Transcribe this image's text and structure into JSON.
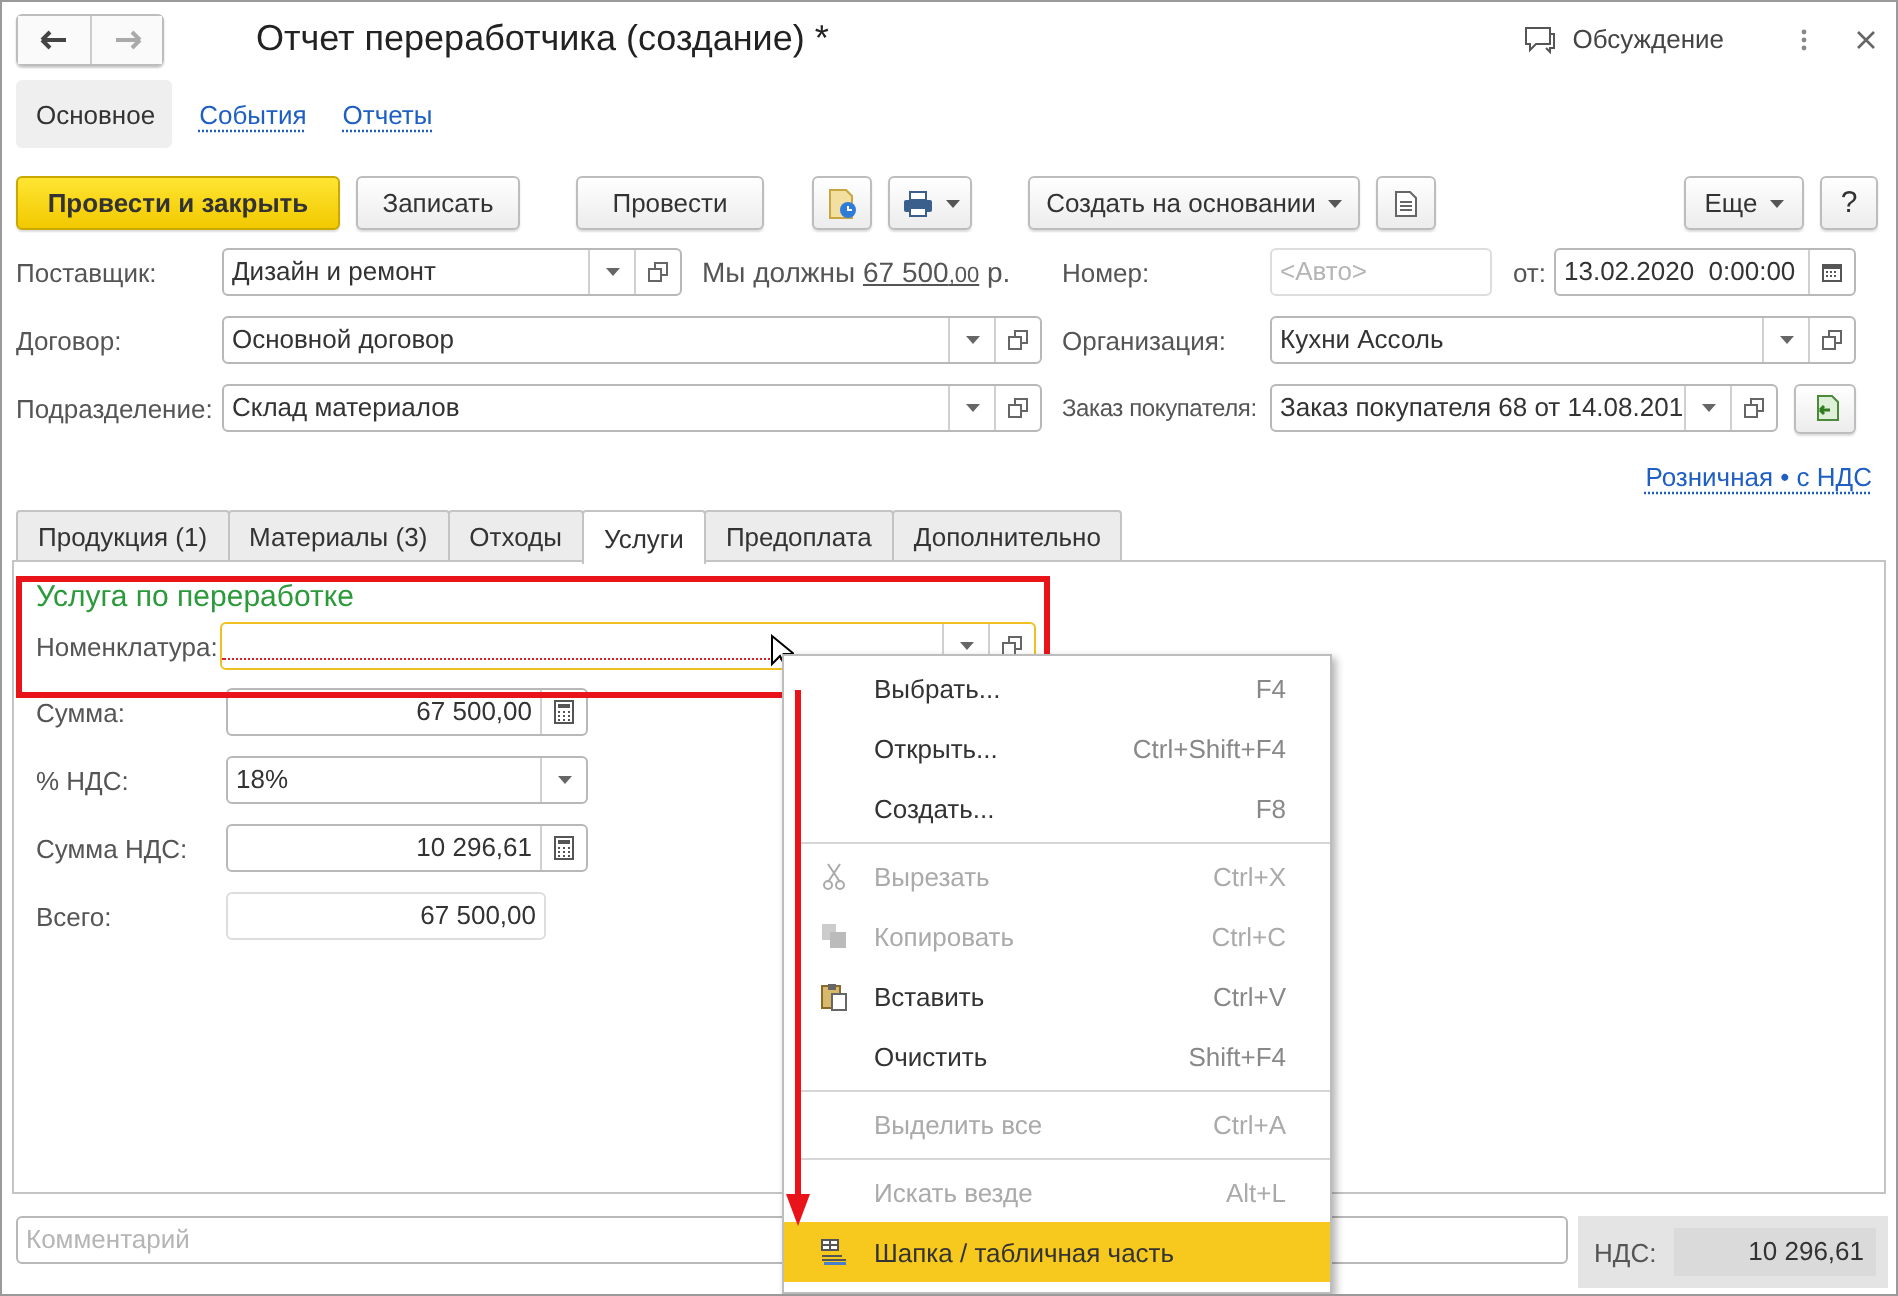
{
  "window": {
    "title": "Отчет переработчика (создание) *",
    "discussion": "Обсуждение"
  },
  "sections": [
    {
      "label": "Основное",
      "selected": true
    },
    {
      "label": "События",
      "selected": false
    },
    {
      "label": "Отчеты",
      "selected": false
    }
  ],
  "toolbar": {
    "primary": "Провести и закрыть",
    "save": "Записать",
    "post": "Провести",
    "create_based": "Создать на основании",
    "more": "Еще",
    "help": "?"
  },
  "header": {
    "supplier": {
      "label": "Поставщик:",
      "value": "Дизайн и ремонт"
    },
    "debt": {
      "prefix": "Мы должны",
      "amount": "67 500",
      "cents": ",00",
      "suffix": "р."
    },
    "number": {
      "label": "Номер:",
      "placeholder": "<Авто>"
    },
    "date": {
      "label": "от:",
      "value": "13.02.2020  0:00:00"
    },
    "contract": {
      "label": "Договор:",
      "value": "Основной договор"
    },
    "organization": {
      "label": "Организация:",
      "value": "Кухни Ассоль"
    },
    "department": {
      "label": "Подразделение:",
      "value": "Склад материалов"
    },
    "order": {
      "label": "Заказ покупателя:",
      "value": "Заказ покупателя 68 от 14.08.201"
    }
  },
  "tax_link": "Розничная • с НДС",
  "tabs": [
    {
      "label": "Продукция (1)",
      "selected": false
    },
    {
      "label": "Материалы (3)",
      "selected": false
    },
    {
      "label": "Отходы",
      "selected": false
    },
    {
      "label": "Услуги",
      "selected": true
    },
    {
      "label": "Предоплата",
      "selected": false
    },
    {
      "label": "Дополнительно",
      "selected": false
    }
  ],
  "service": {
    "group_title": "Услуга по переработке",
    "nomenclature": {
      "label": "Номенклатура:"
    },
    "sum": {
      "label": "Сумма:",
      "value": "67 500,00"
    },
    "vat_rate": {
      "label": "% НДС:",
      "value": "18%"
    },
    "vat_sum": {
      "label": "Сумма НДС:",
      "value": "10 296,61"
    },
    "total": {
      "label": "Всего:",
      "value": "67 500,00"
    }
  },
  "context_menu": [
    {
      "kind": "plain",
      "label": "Выбрать...",
      "shortcut": "F4",
      "disabled": false,
      "selected": false
    },
    {
      "kind": "plain",
      "label": "Открыть...",
      "shortcut": "Ctrl+Shift+F4",
      "disabled": false,
      "selected": false
    },
    {
      "kind": "plain",
      "label": "Создать...",
      "shortcut": "F8",
      "disabled": false,
      "selected": false
    },
    {
      "kind": "separator"
    },
    {
      "kind": "cut",
      "label": "Вырезать",
      "shortcut": "Ctrl+X",
      "disabled": true,
      "selected": false
    },
    {
      "kind": "copy",
      "label": "Копировать",
      "shortcut": "Ctrl+C",
      "disabled": true,
      "selected": false
    },
    {
      "kind": "paste",
      "label": "Вставить",
      "shortcut": "Ctrl+V",
      "disabled": false,
      "selected": false
    },
    {
      "kind": "plain",
      "label": "Очистить",
      "shortcut": "Shift+F4",
      "disabled": false,
      "selected": false
    },
    {
      "kind": "separator"
    },
    {
      "kind": "plain",
      "label": "Выделить все",
      "shortcut": "Ctrl+A",
      "disabled": true,
      "selected": false
    },
    {
      "kind": "separator"
    },
    {
      "kind": "plain",
      "label": "Искать везде",
      "shortcut": "Alt+L",
      "disabled": true,
      "selected": false
    },
    {
      "kind": "layout",
      "label": "Шапка / табличная часть",
      "disabled": false,
      "selected": true
    }
  ],
  "footer": {
    "comment": {
      "placeholder": "Комментарий"
    },
    "vat": {
      "label": "НДС:",
      "value": "10 296,61"
    }
  }
}
